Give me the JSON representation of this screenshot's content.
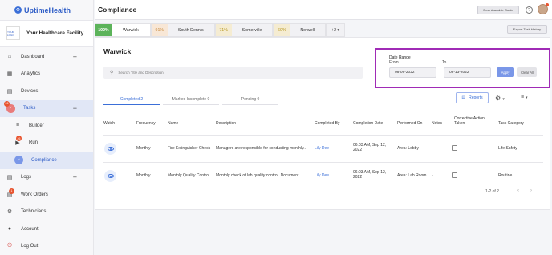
{
  "brand": {
    "name": "UptimeHealth"
  },
  "facility": {
    "name": "Your Healthcare Facility",
    "logo_text": "YOUR LOGO"
  },
  "sidebar": {
    "items": [
      {
        "label": "Dashboard"
      },
      {
        "label": "Analytics"
      },
      {
        "label": "Devices"
      },
      {
        "label": "Tasks",
        "badge": "26"
      },
      {
        "label": "Builder"
      },
      {
        "label": "Run",
        "badge": "26"
      },
      {
        "label": "Compliance"
      },
      {
        "label": "Logs"
      },
      {
        "label": "Work Orders",
        "badge": "1"
      },
      {
        "label": "Technicians"
      },
      {
        "label": "Account"
      },
      {
        "label": "Log Out"
      }
    ]
  },
  "header": {
    "title": "Compliance",
    "download_guide": "Downloadable Guide",
    "help": "?"
  },
  "locations": [
    {
      "pct": "100%",
      "name": "Warwick"
    },
    {
      "pct": "91%",
      "name": "South Dennis"
    },
    {
      "pct": "71%",
      "name": "Somerville"
    },
    {
      "pct": "60%",
      "name": "Norwell"
    }
  ],
  "locations_more": "+2 ▾",
  "export_label": "Export Task History",
  "main": {
    "title": "Warwick",
    "search_placeholder": "Search Title and Description",
    "date_range": {
      "label": "Date Range",
      "from_label": "From",
      "to_label": "To",
      "from_value": "08-06-2022",
      "to_value": "08-13-2022",
      "apply": "Apply",
      "clear": "Clear All"
    },
    "status_tabs": [
      "Completed 2",
      "Marked Incomplete 0",
      "Pending 0"
    ],
    "reports_label": "Reports"
  },
  "table": {
    "headers": {
      "watch": "Watch",
      "frequency": "Frequency",
      "name": "Name",
      "description": "Description",
      "completed_by": "Completed By",
      "completion_date": "Completion Date",
      "performed_on": "Performed On",
      "notes": "Notes",
      "corrective_1": "Corrective Action",
      "corrective_2": "Taken",
      "category": "Task Category"
    },
    "rows": [
      {
        "frequency": "Monthly",
        "name": "Fire Extinguisher Check",
        "description": "Managers are responsible for conducting monthly...",
        "completed_by": "Lily Dee",
        "date_1": "06:03 AM, Sep 12,",
        "date_2": "2022",
        "performed_on": "Area: Lobby",
        "notes": "-",
        "category": "Life Safety"
      },
      {
        "frequency": "Monthly",
        "name": "Monthly Quality Control",
        "description": "Monthly check of lab quality control. Document...",
        "completed_by": "Lily Dee",
        "date_1": "06:03 AM, Sep 12,",
        "date_2": "2022",
        "performed_on": "Area: Lab Room",
        "notes": "-",
        "category": "Routine"
      }
    ],
    "pager": "1-2 of 2"
  }
}
